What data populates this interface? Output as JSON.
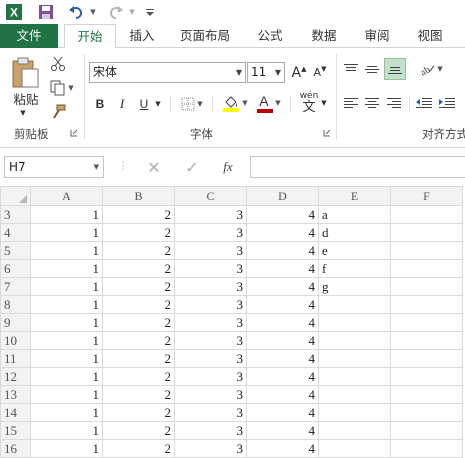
{
  "qat": {
    "icons": [
      "excel-logo-icon",
      "save-icon",
      "undo-icon",
      "redo-icon",
      "customize-icon"
    ]
  },
  "tabs": [
    {
      "label": "文件"
    },
    {
      "label": "开始"
    },
    {
      "label": "插入"
    },
    {
      "label": "页面布局"
    },
    {
      "label": "公式"
    },
    {
      "label": "数据"
    },
    {
      "label": "审阅"
    },
    {
      "label": "视图"
    }
  ],
  "ribbon": {
    "paste_label": "粘贴",
    "clipboard_label": "剪贴板",
    "font_label": "字体",
    "align_label": "对齐方式",
    "font_name": "宋体",
    "font_size": "11",
    "bold": "B",
    "italic": "I",
    "underline": "U",
    "font_color_glyph": "A",
    "wen": "wén",
    "wen_char": "文",
    "grow_font": "A",
    "shrink_font": "A"
  },
  "formula_bar": {
    "name_box": "H7",
    "fx": "fx",
    "formula": ""
  },
  "sheet": {
    "columns": [
      "A",
      "B",
      "C",
      "D",
      "E",
      "F"
    ],
    "rows": [
      {
        "n": "3",
        "a": "1",
        "b": "2",
        "c": "3",
        "d": "4",
        "e": "a"
      },
      {
        "n": "4",
        "a": "1",
        "b": "2",
        "c": "3",
        "d": "4",
        "e": "d"
      },
      {
        "n": "5",
        "a": "1",
        "b": "2",
        "c": "3",
        "d": "4",
        "e": "e"
      },
      {
        "n": "6",
        "a": "1",
        "b": "2",
        "c": "3",
        "d": "4",
        "e": "f"
      },
      {
        "n": "7",
        "a": "1",
        "b": "2",
        "c": "3",
        "d": "4",
        "e": "g"
      },
      {
        "n": "8",
        "a": "1",
        "b": "2",
        "c": "3",
        "d": "4",
        "e": ""
      },
      {
        "n": "9",
        "a": "1",
        "b": "2",
        "c": "3",
        "d": "4",
        "e": ""
      },
      {
        "n": "10",
        "a": "1",
        "b": "2",
        "c": "3",
        "d": "4",
        "e": ""
      },
      {
        "n": "11",
        "a": "1",
        "b": "2",
        "c": "3",
        "d": "4",
        "e": ""
      },
      {
        "n": "12",
        "a": "1",
        "b": "2",
        "c": "3",
        "d": "4",
        "e": ""
      },
      {
        "n": "13",
        "a": "1",
        "b": "2",
        "c": "3",
        "d": "4",
        "e": ""
      },
      {
        "n": "14",
        "a": "1",
        "b": "2",
        "c": "3",
        "d": "4",
        "e": ""
      },
      {
        "n": "15",
        "a": "1",
        "b": "2",
        "c": "3",
        "d": "4",
        "e": ""
      },
      {
        "n": "16",
        "a": "1",
        "b": "2",
        "c": "3",
        "d": "4",
        "e": ""
      }
    ]
  },
  "colors": {
    "brand": "#217346",
    "font_color": "#c00000",
    "highlight": "#ffff00"
  }
}
